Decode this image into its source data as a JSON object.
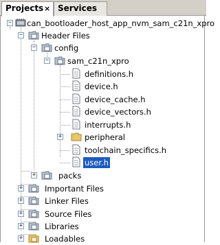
{
  "tabs": [
    {
      "label": "Projects",
      "close": "×"
    },
    {
      "label": "Services"
    }
  ],
  "tree": {
    "project": "can_bootloader_host_app_nvm_sam_c21n_xpro",
    "header_files": "Header Files",
    "config": "config",
    "board": "sam_c21n_xpro",
    "files": [
      "definitions.h",
      "device.h",
      "device_cache.h",
      "device_vectors.h",
      "interrupts.h",
      "peripheral",
      "toolchain_specifics.h",
      "user.h"
    ],
    "packs": "packs",
    "important_files": "Important Files",
    "linker_files": "Linker Files",
    "source_files": "Source Files",
    "libraries": "Libraries",
    "loadables": "Loadables"
  },
  "toggle_symbols": {
    "expanded": "−",
    "collapsed": "+"
  },
  "colors": {
    "selection": "#1c5bc0",
    "folder": "#e8c66a",
    "file": "#ffffff"
  }
}
